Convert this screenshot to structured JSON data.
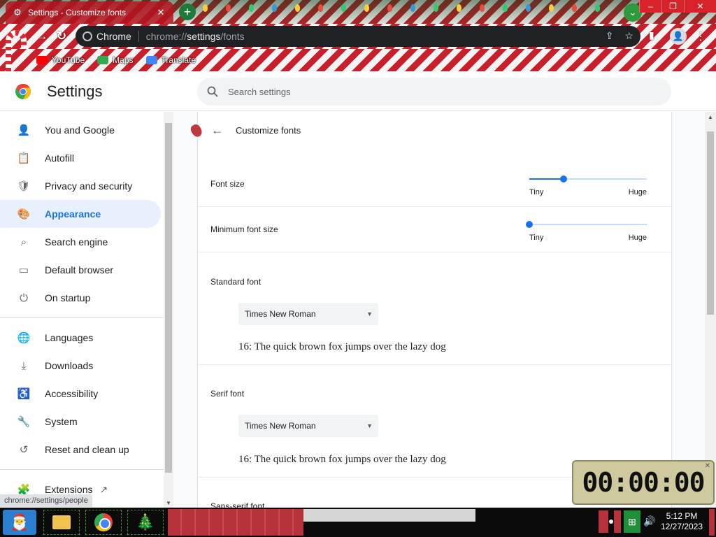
{
  "browser": {
    "tab_title": "Settings - Customize fonts",
    "url_scheme": "chrome://",
    "url_host": "settings",
    "url_path": "/fonts",
    "site_chip_label": "Chrome",
    "bookmarks": [
      {
        "label": "YouTube",
        "icon": "youtube-icon",
        "color": "#ff0000"
      },
      {
        "label": "Maps",
        "icon": "maps-icon",
        "color": "#34a853"
      },
      {
        "label": "Translate",
        "icon": "translate-icon",
        "color": "#4285f4"
      }
    ]
  },
  "settings": {
    "title": "Settings",
    "search_placeholder": "Search settings"
  },
  "sidebar": {
    "items": [
      {
        "label": "You and Google",
        "icon": "person-icon",
        "glyph": "👤",
        "active": false
      },
      {
        "label": "Autofill",
        "icon": "clipboard-icon",
        "glyph": "📋",
        "active": false
      },
      {
        "label": "Privacy and security",
        "icon": "shield-icon",
        "glyph": "🛡",
        "active": false
      },
      {
        "label": "Appearance",
        "icon": "palette-icon",
        "glyph": "🎨",
        "active": true
      },
      {
        "label": "Search engine",
        "icon": "search-icon",
        "glyph": "⌕",
        "active": false
      },
      {
        "label": "Default browser",
        "icon": "browser-icon",
        "glyph": "▭",
        "active": false
      },
      {
        "label": "On startup",
        "icon": "power-icon",
        "glyph": "⏻",
        "active": false
      }
    ],
    "items2": [
      {
        "label": "Languages",
        "icon": "globe-icon",
        "glyph": "🌐",
        "active": false
      },
      {
        "label": "Downloads",
        "icon": "download-icon",
        "glyph": "⤓",
        "active": false
      },
      {
        "label": "Accessibility",
        "icon": "accessibility-icon",
        "glyph": "♿",
        "active": false
      },
      {
        "label": "System",
        "icon": "wrench-icon",
        "glyph": "🔧",
        "active": false
      },
      {
        "label": "Reset and clean up",
        "icon": "history-icon",
        "glyph": "↺",
        "active": false
      }
    ],
    "extensions_label": "Extensions"
  },
  "main": {
    "page_title": "Customize fonts",
    "font_size": {
      "label": "Font size",
      "min_label": "Tiny",
      "max_label": "Huge",
      "value_fraction": 0.29
    },
    "min_font_size": {
      "label": "Minimum font size",
      "min_label": "Tiny",
      "max_label": "Huge",
      "value_fraction": 0.0
    },
    "standard_font": {
      "label": "Standard font",
      "selected": "Times New Roman",
      "sample": "16: The quick brown fox jumps over the lazy dog"
    },
    "serif_font": {
      "label": "Serif font",
      "selected": "Times New Roman",
      "sample": "16: The quick brown fox jumps over the lazy dog"
    },
    "sans_serif_font": {
      "label": "Sans-serif font"
    }
  },
  "status_bar": {
    "url": "chrome://settings/people"
  },
  "stopwatch": {
    "display": "00:00:00"
  },
  "taskbar": {
    "time": "5:12 PM",
    "date": "12/27/2023"
  },
  "colors": {
    "accent": "#1a73e8",
    "active_bg": "#e8f0fe",
    "theme_red": "#c8202a"
  }
}
